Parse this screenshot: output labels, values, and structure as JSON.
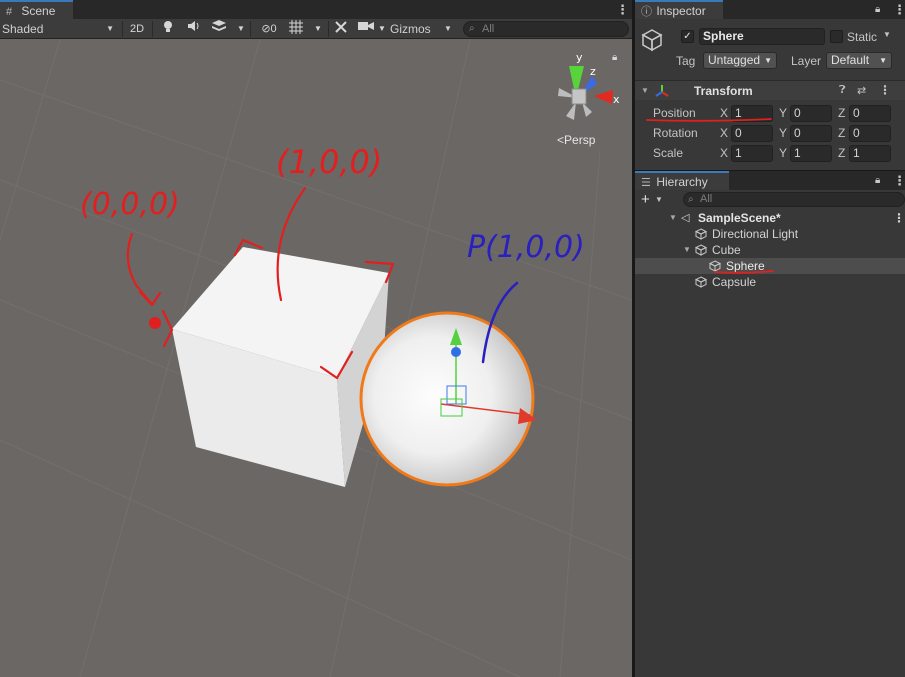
{
  "scene_panel": {
    "tab_title": "Scene",
    "toolbar": {
      "shading_mode": "Shaded",
      "view_2d_label": "2D",
      "hidden_count": "0",
      "gizmos_label": "Gizmos",
      "search_placeholder": "All"
    },
    "orientation_gizmo": {
      "y_label": "y",
      "z_label": "z",
      "x_label": "x",
      "projection_label": "Persp"
    },
    "annotations": {
      "cube_corner_label": "(0,0,0)",
      "cube_edge_label": "(1,0,0)",
      "sphere_label": "P(1,0,0)"
    }
  },
  "inspector": {
    "tab_title": "Inspector",
    "object_name": "Sphere",
    "static_label": "Static",
    "tag_label": "Tag",
    "tag_value": "Untagged",
    "layer_label": "Layer",
    "layer_value": "Default",
    "transform": {
      "title": "Transform",
      "position": {
        "label": "Position",
        "x": "1",
        "y": "0",
        "z": "0"
      },
      "rotation": {
        "label": "Rotation",
        "x": "0",
        "y": "0",
        "z": "0"
      },
      "scale": {
        "label": "Scale",
        "x": "1",
        "y": "1",
        "z": "1"
      },
      "axis_x": "X",
      "axis_y": "Y",
      "axis_z": "Z"
    }
  },
  "hierarchy": {
    "tab_title": "Hierarchy",
    "search_placeholder": "All",
    "scene_name": "SampleScene*",
    "items": [
      {
        "label": "Directional Light"
      },
      {
        "label": "Cube"
      },
      {
        "label": "Sphere"
      },
      {
        "label": "Capsule"
      }
    ]
  },
  "colors": {
    "selection_outline": "#f07a1a",
    "annotation_red": "#e21f1f",
    "annotation_blue": "#2a1fbf",
    "accent_tab": "#3a79bb"
  }
}
